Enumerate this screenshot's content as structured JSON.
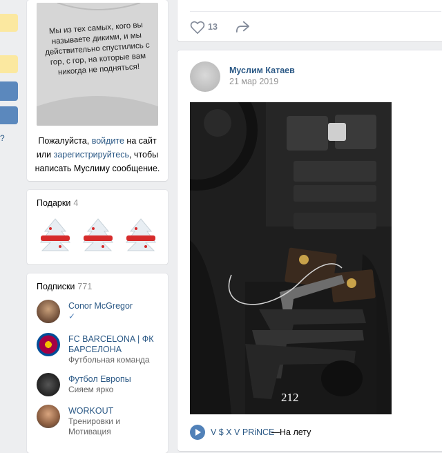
{
  "profile": {
    "login_note": {
      "before": "Пожалуйста, ",
      "login_link": "войдите",
      "middle": " на сайт или ",
      "register_link": "зарегистрируйтесь",
      "after": ", чтобы написать Муслиму сообщение."
    },
    "shirt_text": "Мы из тех самых, кого вы называете дикими, и мы действительно спустились с гор, с гор, на которые вам никогда не подняться!"
  },
  "gifts": {
    "title": "Подарки",
    "count": "4",
    "items": [
      "gift-tree-1",
      "gift-tree-2",
      "gift-tree-3"
    ]
  },
  "subscriptions": {
    "title": "Подписки",
    "count": "771",
    "items": [
      {
        "name": "Conor McGregor",
        "desc": "✓",
        "avatar_color": "#8a6a52"
      },
      {
        "name": "FC BARCELONA | ФК БАРСЕЛОНА",
        "desc": "Футбольная команда",
        "avatar_color": "#a50044"
      },
      {
        "name": "Футбол Европы",
        "desc": "Сияем ярко",
        "avatar_color": "#2b2b2b"
      },
      {
        "name": "WORKOUT",
        "desc": "Тренировки и Мотивация",
        "avatar_color": "#3a6ea5"
      }
    ]
  },
  "post_top": {
    "likes": "13",
    "like_icon": "heart-icon",
    "share_icon": "share-arrow-icon"
  },
  "post": {
    "author": "Муслим Катаев",
    "date": "21 мар 2019",
    "photo_caption": "212",
    "audio": {
      "artist": "V $ X V PRiNCE",
      "separator": "—",
      "title": "На лету"
    }
  },
  "colors": {
    "link": "#2a5885",
    "accent": "#5181b8",
    "background": "#edeef0"
  }
}
